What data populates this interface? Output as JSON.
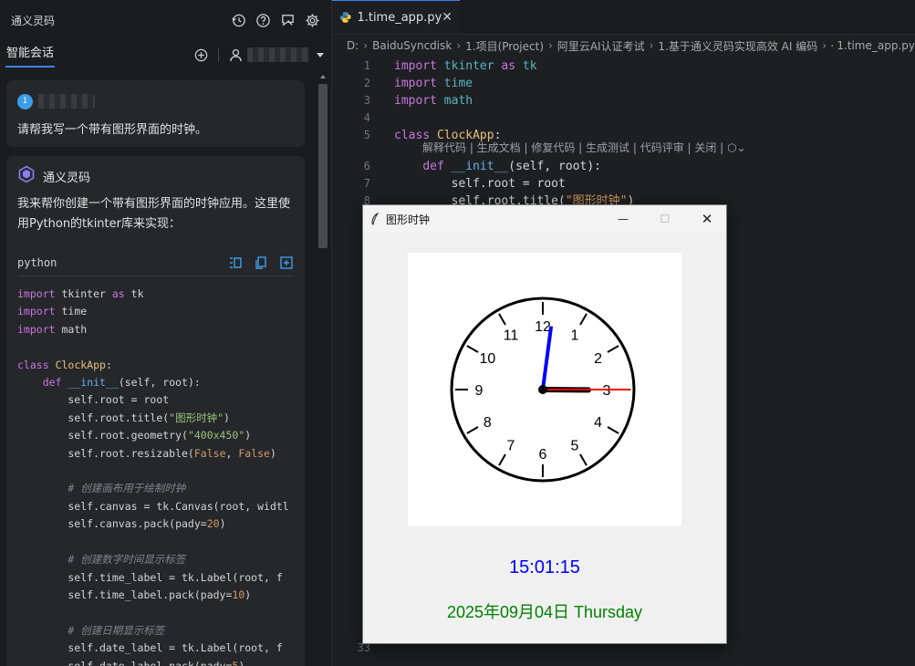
{
  "left_panel": {
    "title": "通义灵码",
    "header_icons": [
      "history-icon",
      "help-icon",
      "chat-settings-icon",
      "gear-icon"
    ],
    "tab": "智能会话",
    "user_message": "请帮我写一个带有图形界面的时钟。",
    "user_badge": "1",
    "assistant_name": "通义灵码",
    "assistant_text": "我来帮你创建一个带有图形界面的时钟应用。这里使用Python的tkinter库来实现：",
    "code_lang": "python"
  },
  "editor": {
    "tab_label": "1.time_app.py",
    "breadcrumb": [
      "D:",
      "BaiduSyncdisk",
      "1.项目(Project)",
      "阿里云AI认证考试",
      "1.基于通义灵码实现高效 AI 编码",
      "1.time_app.py"
    ],
    "codelens": "解释代码 | 生成文档 | 修复代码 | 生成测试 | 代码评审 | 关闭 |",
    "line_numbers": {
      "l1": "1",
      "l2": "2",
      "l3": "3",
      "l4": "4",
      "l5": "5",
      "l6": "6",
      "l7": "7",
      "l8": "8",
      "l33": "33"
    }
  },
  "tk_window": {
    "title": "图形时钟",
    "time": "15:01:15",
    "date": "2025年09月04日 Thursday",
    "clock": {
      "numbers": [
        "12",
        "1",
        "2",
        "3",
        "4",
        "5",
        "6",
        "7",
        "8",
        "9",
        "10",
        "11"
      ],
      "hour": 3,
      "minute": 1,
      "second": 15
    }
  },
  "colors": {
    "accent": "#3b82f6",
    "time_label": "#0000ff",
    "date_label": "#008000",
    "minute_hand": "#0000ff",
    "second_hand": "#ff0000",
    "hour_hand": "#000000"
  }
}
